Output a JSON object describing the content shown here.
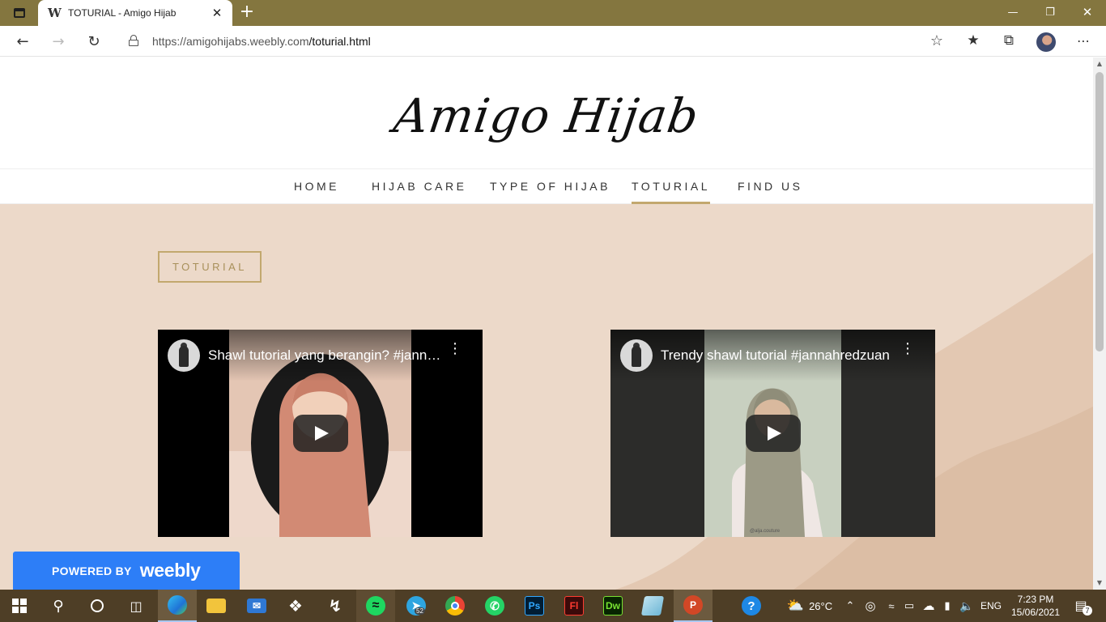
{
  "browser": {
    "tab_title": "TOTURIAL - Amigo Hijab",
    "tab_favicon": "W",
    "url_host": "https://amigohijabs.weebly.com",
    "url_path": "/toturial.html"
  },
  "site": {
    "logo": "Amigo Hijab",
    "nav": [
      {
        "label": "HOME"
      },
      {
        "label": "HIJAB CARE"
      },
      {
        "label": "TYPE OF HIJAB"
      },
      {
        "label": "TOTURIAL",
        "active": true
      },
      {
        "label": "FIND US"
      }
    ],
    "page_label": "TOTURIAL",
    "videos": [
      {
        "title": "Shawl tutorial yang berangin? #janna..."
      },
      {
        "title": "Trendy shawl tutorial #jannahredzuan",
        "watermark": "@alja.couture"
      }
    ],
    "badge": {
      "powered_by": "POWERED BY",
      "brand": "weebly"
    }
  },
  "taskbar": {
    "weather": "26°C",
    "language": "ENG",
    "time": "7:23 PM",
    "date": "15/06/2021",
    "telegram_badge": "52",
    "notifications": "7"
  },
  "colors": {
    "titlebar": "#84763f",
    "accent_gold": "#c2a86e",
    "content_bg": "#ecd9c9",
    "weebly_blue": "#2d7ef7",
    "taskbar": "#4e3e26"
  }
}
